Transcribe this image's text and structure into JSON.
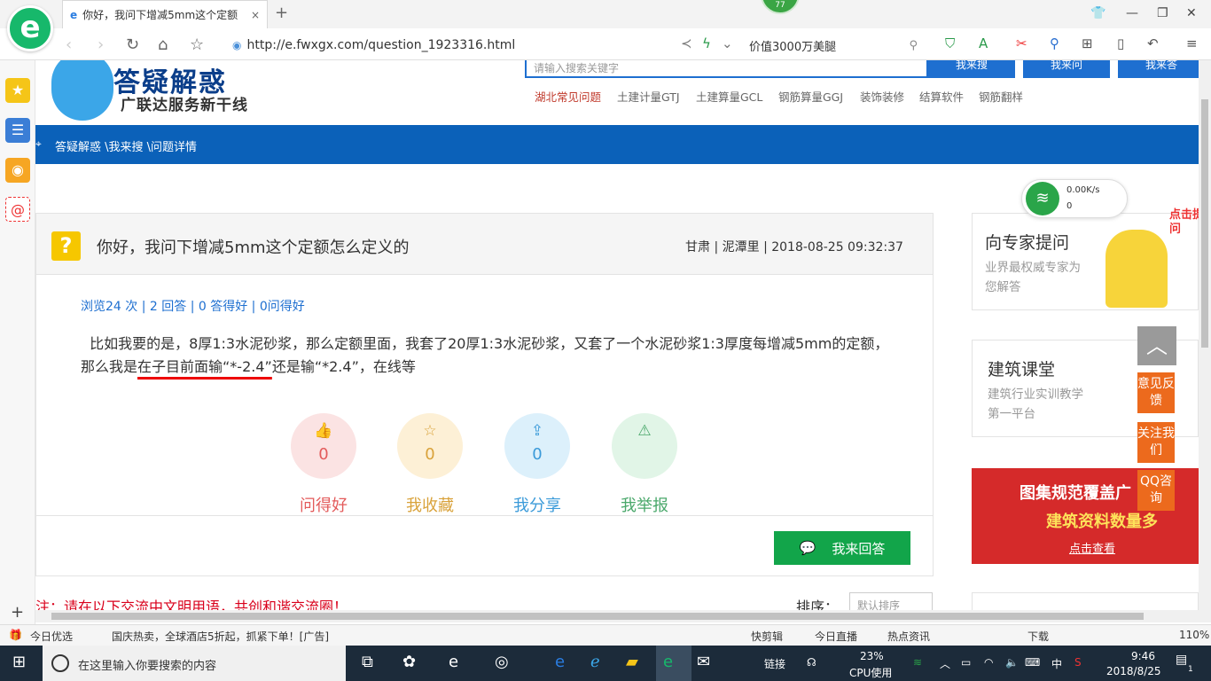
{
  "browser": {
    "tab_title": "你好，我问下增减5mm这个定额",
    "tab_close": "×",
    "new_tab": "+",
    "badge": "77",
    "url": "http://e.fwxgx.com/question_1923316.html",
    "search_text": "价值3000万美腿"
  },
  "site": {
    "title": "答疑解惑",
    "subtitle": "广联达服务新干线",
    "search_placeholder": "请输入搜索关键字",
    "buttons": [
      "我来搜",
      "我来问",
      "我来答"
    ],
    "hot_links": [
      "湖北常见问题",
      "土建计量GTJ",
      "土建算量GCL",
      "钢筋算量GGJ",
      "装饰装修",
      "结算软件",
      "钢筋翻样"
    ],
    "breadcrumb": "答疑解惑 \\我来搜 \\问题详情"
  },
  "question": {
    "title": "你好，我问下增减5mm这个定额怎么定义的",
    "meta": "甘肃 | 泥潭里 | 2018-08-25 09:32:37",
    "stats": "浏览24 次 | 2 回答 | 0 答得好 | 0问得好",
    "body_part1": "比如我要的是，8厚1:3水泥砂浆，那么定额里面，我套了20厚1:3水泥砂浆，又套了一个水泥砂浆1:3厚度每增减5mm的定额，那么我是",
    "body_highlight": "在子目前面输“*-2.4”",
    "body_part2": "还是输“*2.4”，在线等"
  },
  "actions": [
    {
      "label": "问得好",
      "count": "0",
      "color": "#e35b5b",
      "bg": "#fbe3e3"
    },
    {
      "label": "我收藏",
      "count": "0",
      "color": "#d9a23a",
      "bg": "#fdf0d6"
    },
    {
      "label": "我分享",
      "count": "0",
      "color": "#3a9ad9",
      "bg": "#dcf0fb"
    },
    {
      "label": "我举报",
      "count": "0",
      "color": "#4aa86b",
      "bg": "#e1f5e7"
    }
  ],
  "answer_button": "我来回答",
  "bottom": {
    "note": "注：请在以下交流中文明用语，共创和谐交流圈！",
    "sort_label": "排序：",
    "sort_value": "默认排序"
  },
  "right": {
    "expert_title": "向专家提问",
    "expert_sub": "业界最权威专家为您解答",
    "click_bubble": "点击提问",
    "class_title": "建筑课堂",
    "class_sub": "建筑行业实训教学第一平台",
    "banner_line1": "图集规范覆盖广",
    "banner_line2": "建筑资料数量多",
    "banner_btn": "点击查看",
    "side_feedback": "意见反馈",
    "side_follow": "关注我们",
    "side_qq": "QQ咨询"
  },
  "wifi": {
    "speed": "0.00K/s",
    "count": "0"
  },
  "statusbar": {
    "left1": "今日优选",
    "ad": "国庆热卖，全球酒店5折起，抓紧下单！[广告]",
    "items": [
      "快剪辑",
      "今日直播",
      "热点资讯",
      "下载"
    ],
    "zoom": "110%"
  },
  "taskbar": {
    "search": "在这里输入你要搜索的内容",
    "link": "链接",
    "cpu_pct": "23%",
    "cpu_label": "CPU使用",
    "ime": "中",
    "time": "9:46",
    "date": "2018/8/25",
    "notif": "1"
  }
}
